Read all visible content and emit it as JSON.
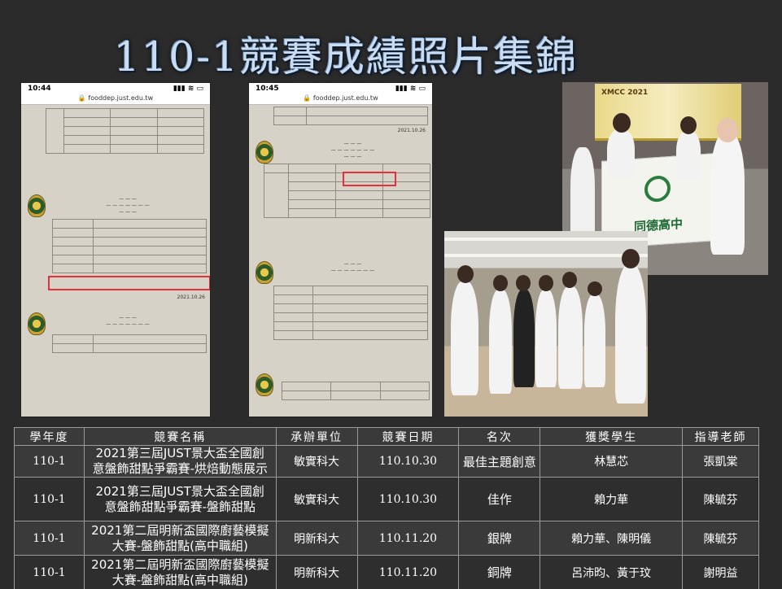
{
  "title": "110-1競賽成績照片集錦",
  "phone_left": {
    "time": "10:44",
    "url": "fooddep.just.edu.tw",
    "date": "2021.10.26"
  },
  "phone_mid": {
    "time": "10:45",
    "url": "fooddep.just.edu.tw",
    "date": "2021.10.26"
  },
  "photo_banner": {
    "flag_text": "同德高中",
    "banner_text": "XMCC 2021"
  },
  "table": {
    "headers": [
      "學年度",
      "競賽名稱",
      "承辦單位",
      "競賽日期",
      "名次",
      "獲獎學生",
      "指導老師"
    ],
    "rows": [
      {
        "year": "110-1",
        "name_line1": "2021第三屆JUST景大盃全國創",
        "name_line2": "意盤飾甜點爭霸賽-烘焙動態展示",
        "organizer": "敏實科大",
        "date": "110.10.30",
        "rank": "最佳主題創意",
        "students": "林慧芯",
        "teacher": "張凱棠"
      },
      {
        "year": "110-1",
        "name_line1": "2021第三屆JUST景大盃全國創",
        "name_line2": "意盤飾甜點爭霸賽-盤飾甜點",
        "organizer": "敏實科大",
        "date": "110.10.30",
        "rank": "佳作",
        "students": "賴力華",
        "teacher": "陳毓芬"
      },
      {
        "year": "110-1",
        "name_line1": "2021第二屆明新盃國際廚藝模擬",
        "name_line2": "大賽-盤飾甜點(高中職組)",
        "organizer": "明新科大",
        "date": "110.11.20",
        "rank": "銀牌",
        "students": "賴力華、陳明儀",
        "teacher": "陳毓芬"
      },
      {
        "year": "110-1",
        "name_line1": "2021第二屆明新盃國際廚藝模擬",
        "name_line2": "大賽-盤飾甜點(高中職組)",
        "organizer": "明新科大",
        "date": "110.11.20",
        "rank": "銅牌",
        "students": "呂沛昀、黃于玟",
        "teacher": "謝明益"
      }
    ]
  }
}
